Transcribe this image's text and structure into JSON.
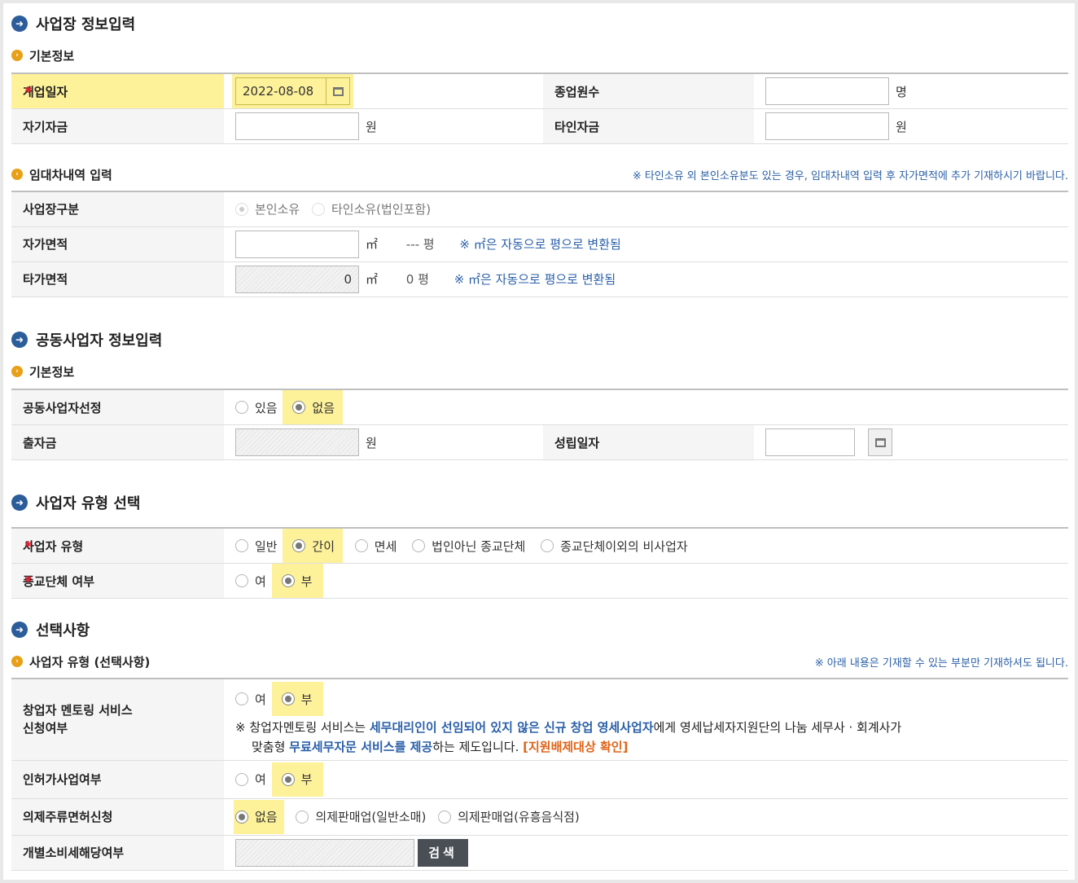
{
  "section1": {
    "title": "사업장 정보입력",
    "basic_title": "기본정보",
    "open_date_label": "개업일자",
    "open_date_value": "2022-08-08",
    "employees_label": "종업원수",
    "employees_unit": "명",
    "own_capital_label": "자기자금",
    "own_capital_unit": "원",
    "other_capital_label": "타인자금",
    "other_capital_unit": "원",
    "lease_title": "임대차내역 입력",
    "lease_note": "※ 타인소유 외 본인소유분도 있는 경우, 임대차내역 입력 후 자가면적에 추가 기재하시기 바랍니다.",
    "site_type_label": "사업장구분",
    "site_type_options": [
      "본인소유",
      "타인소유(법인포함)"
    ],
    "own_area_label": "자가면적",
    "own_area_unit": "㎡",
    "own_area_pyeong": "--- 평",
    "area_note": "※ ㎡은 자동으로 평으로 변환됨",
    "other_area_label": "타가면적",
    "other_area_value": "0",
    "other_area_unit": "㎡",
    "other_area_pyeong": "0 평"
  },
  "section2": {
    "title": "공동사업자 정보입력",
    "basic_title": "기본정보",
    "joint_select_label": "공동사업자선정",
    "joint_options": [
      "있음",
      "없음"
    ],
    "investment_label": "출자금",
    "investment_unit": "원",
    "established_label": "성립일자"
  },
  "section3": {
    "title": "사업자 유형 선택",
    "biz_type_label": "사업자 유형",
    "biz_type_options": [
      "일반",
      "간이",
      "면세",
      "법인아닌 종교단체",
      "종교단체이외의 비사업자"
    ],
    "religious_label": "종교단체 여부",
    "religious_options": [
      "여",
      "부"
    ]
  },
  "section4": {
    "title": "선택사항",
    "sub_title": "사업자 유형 (선택사항)",
    "note": "※ 아래 내용은 기재할 수 있는 부분만 기재하셔도 됩니다.",
    "mentoring_label_1": "창업자 멘토링 서비스",
    "mentoring_label_2": "신청여부",
    "mentoring_options": [
      "여",
      "부"
    ],
    "mentoring_desc": {
      "p1": "※ 창업자멘토링 서비스는 ",
      "b1": "세무대리인이 선임되어 있지 않은 신규 창업 영세사업자",
      "p2": "에게 영세납세자지원단의 나눔 세무사 · 회계사가",
      "p3": "맞춤형 ",
      "b2": "무료세무자문 서비스를 제공",
      "p4": "하는 제도입니다. ",
      "o1": "[지원배제대상 확인]"
    },
    "license_label": "인허가사업여부",
    "license_options": [
      "여",
      "부"
    ],
    "liquor_label": "의제주류면허신청",
    "liquor_options": [
      "없음",
      "의제판매업(일반소매)",
      "의제판매업(유흥음식점)"
    ],
    "excise_label": "개별소비세해당여부",
    "search_button": "검색"
  }
}
